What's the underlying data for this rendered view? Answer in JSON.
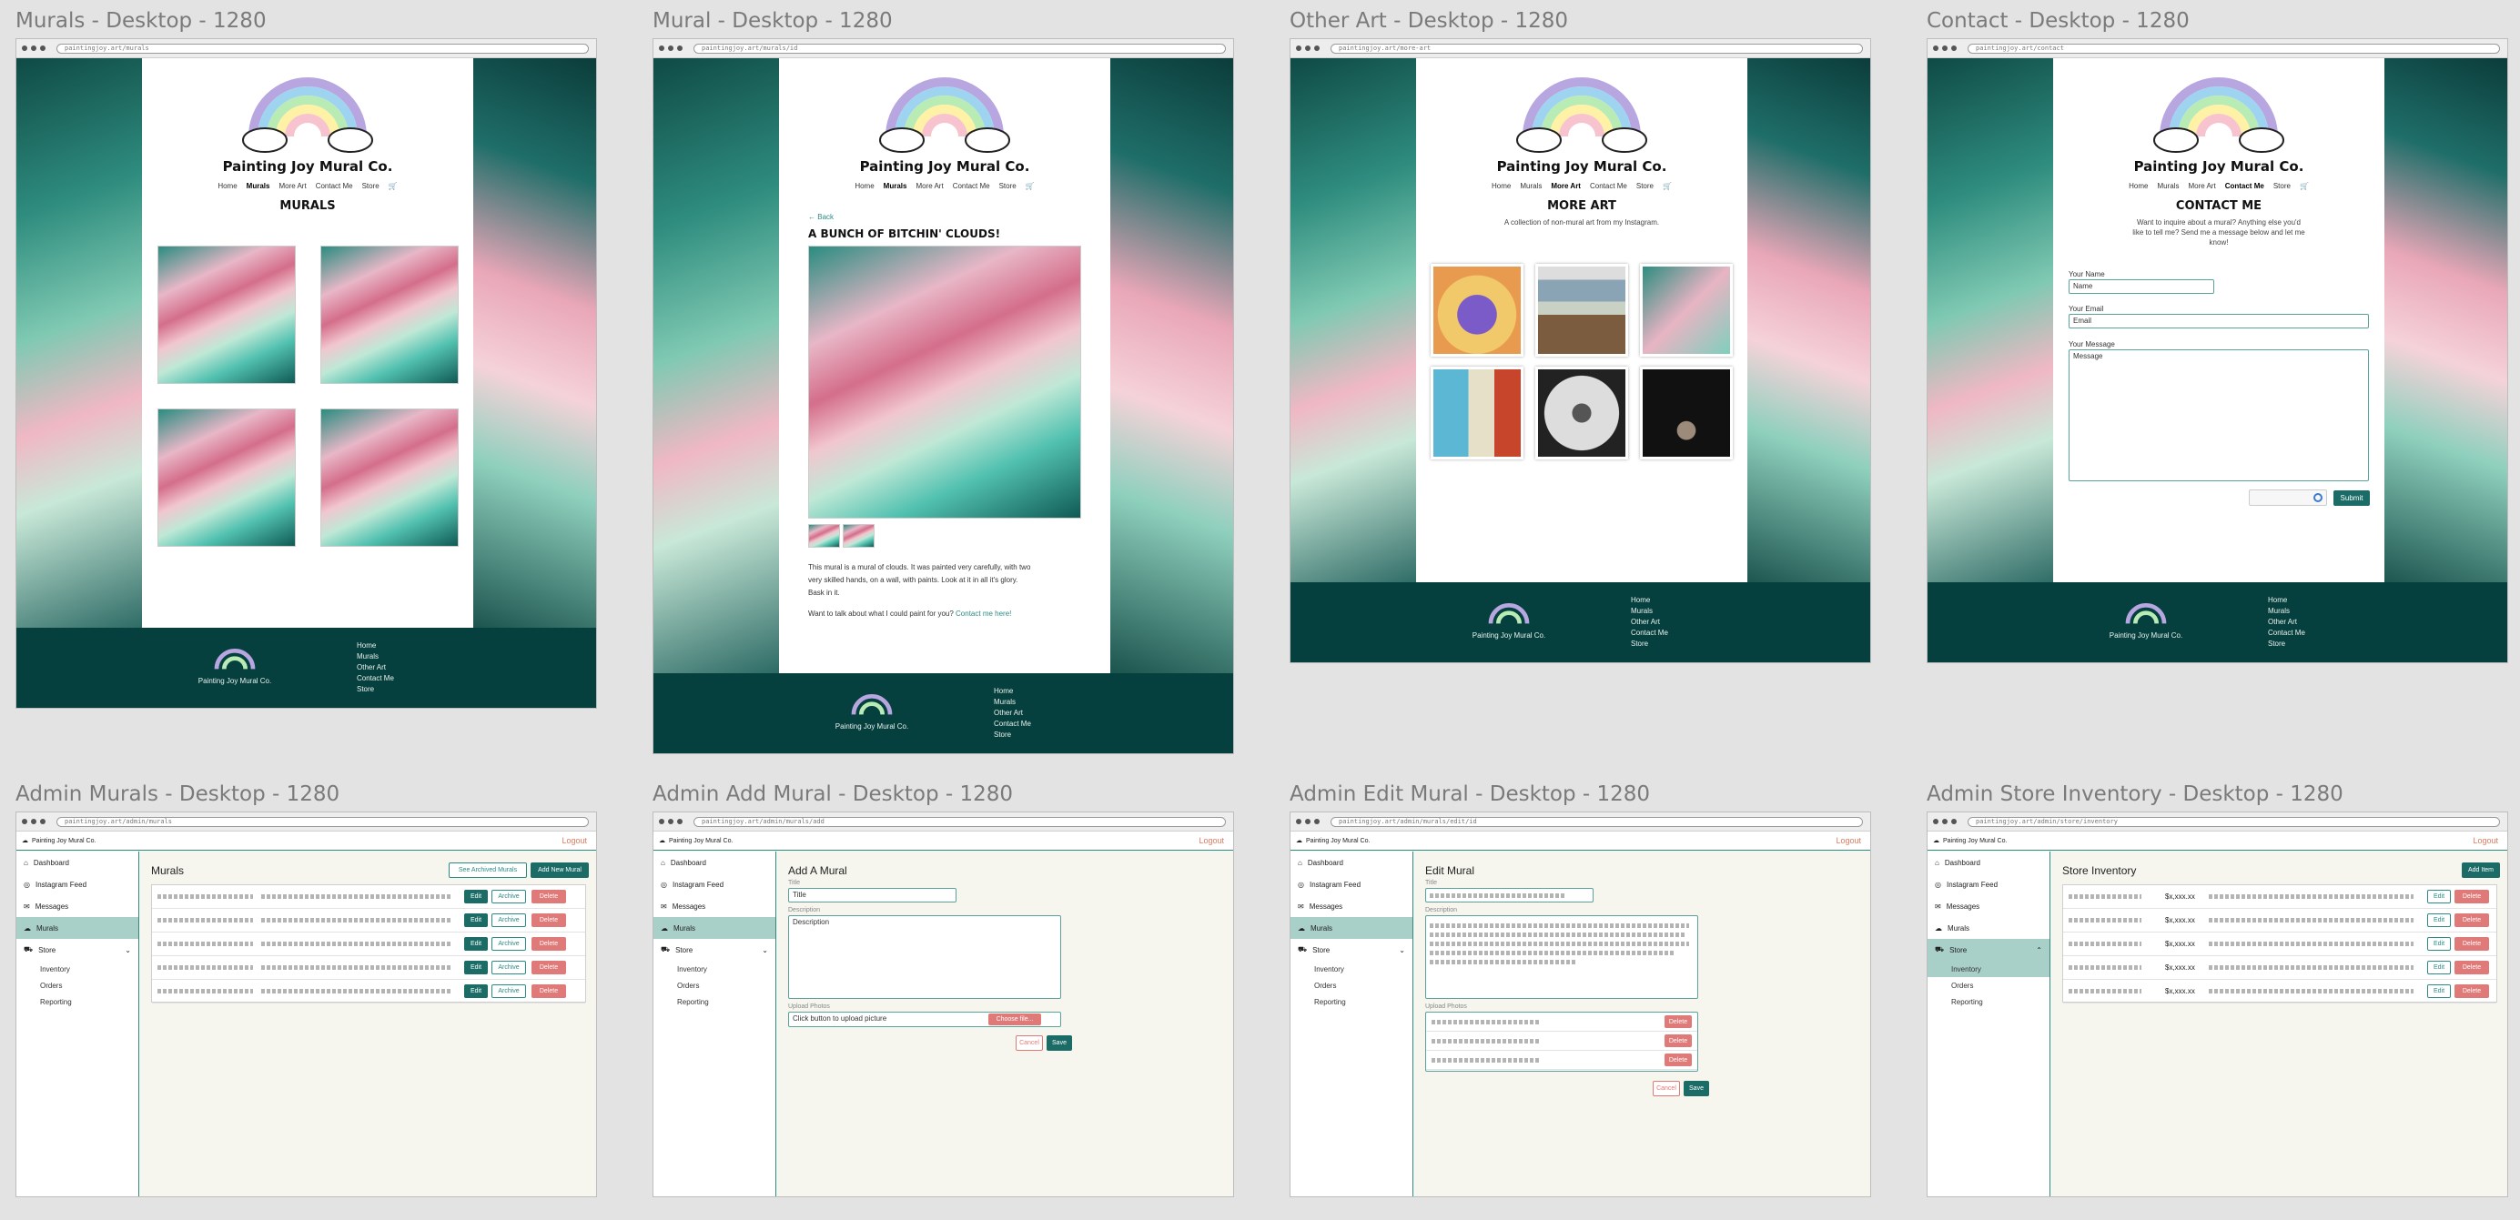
{
  "frames": [
    {
      "label": "Murals - Desktop - 1280",
      "url": "paintingjoy.art/murals"
    },
    {
      "label": "Mural - Desktop - 1280",
      "url": "paintingjoy.art/murals/id"
    },
    {
      "label": "Other Art - Desktop - 1280",
      "url": "paintingjoy.art/more-art"
    },
    {
      "label": "Contact - Desktop - 1280",
      "url": "paintingjoy.art/contact"
    },
    {
      "label": "Admin Murals - Desktop - 1280",
      "url": "paintingjoy.art/admin/murals"
    },
    {
      "label": "Admin Add Mural - Desktop - 1280",
      "url": "paintingjoy.art/admin/murals/add"
    },
    {
      "label": "Admin Edit Mural - Desktop - 1280",
      "url": "paintingjoy.art/admin/murals/edit/id"
    },
    {
      "label": "Admin Store Inventory - Desktop - 1280",
      "url": "paintingjoy.art/admin/store/inventory"
    }
  ],
  "site": {
    "title": "Painting Joy Mural Co.",
    "nav": [
      "Home",
      "Murals",
      "More Art",
      "Contact Me",
      "Store"
    ],
    "footer_links": [
      "Home",
      "Murals",
      "Other Art",
      "Contact Me",
      "Store"
    ]
  },
  "murals_page": {
    "heading": "MURALS"
  },
  "mural_page": {
    "back": "Back",
    "heading": "A BUNCH OF BITCHIN' CLOUDS!",
    "body1": "This mural is a mural of clouds. It was painted very carefully, with two very skilled hands, on a wall, with paints. Look at it in all it's glory. Bask in it.",
    "body2": "Want to talk about what I could paint for you?",
    "body2_link": "Contact me here!"
  },
  "other_art_page": {
    "heading": "MORE ART",
    "sub": "A collection of non-mural art from my Instagram."
  },
  "contact_page": {
    "heading": "CONTACT ME",
    "sub": "Want to inquire about a mural? Anything else you'd like to tell me? Send me a message below and let me know!",
    "name_label": "Your Name",
    "name_placeholder": "Name",
    "email_label": "Your Email",
    "email_placeholder": "Email",
    "msg_label": "Your Message",
    "msg_placeholder": "Message",
    "submit": "Submit"
  },
  "admin": {
    "brand": "Painting Joy Mural Co.",
    "logout": "Logout",
    "sidebar": [
      "Dashboard",
      "Instagram Feed",
      "Messages",
      "Murals",
      "Store"
    ],
    "store_sub": [
      "Inventory",
      "Orders",
      "Reporting"
    ],
    "murals": {
      "title": "Murals",
      "archived": "See Archived Murals",
      "add": "Add New Mural",
      "edit": "Edit",
      "archive": "Archive",
      "delete": "Delete"
    },
    "add_mural": {
      "title": "Add A Mural",
      "title_label": "Title",
      "title_ph": "Title",
      "desc_label": "Description",
      "desc_ph": "Description",
      "upload_label": "Upload Photos",
      "upload_ph": "Click button to upload picture",
      "choose": "Choose file...",
      "cancel": "Cancel",
      "save": "Save"
    },
    "edit_mural": {
      "title": "Edit Mural",
      "title_label": "Title",
      "desc_label": "Description",
      "upload_label": "Upload Photos",
      "delete": "Delete",
      "cancel": "Cancel",
      "save": "Save"
    },
    "inventory": {
      "title": "Store Inventory",
      "add": "Add Item",
      "price": "$x,xxx.xx",
      "edit": "Edit",
      "delete": "Delete"
    }
  }
}
